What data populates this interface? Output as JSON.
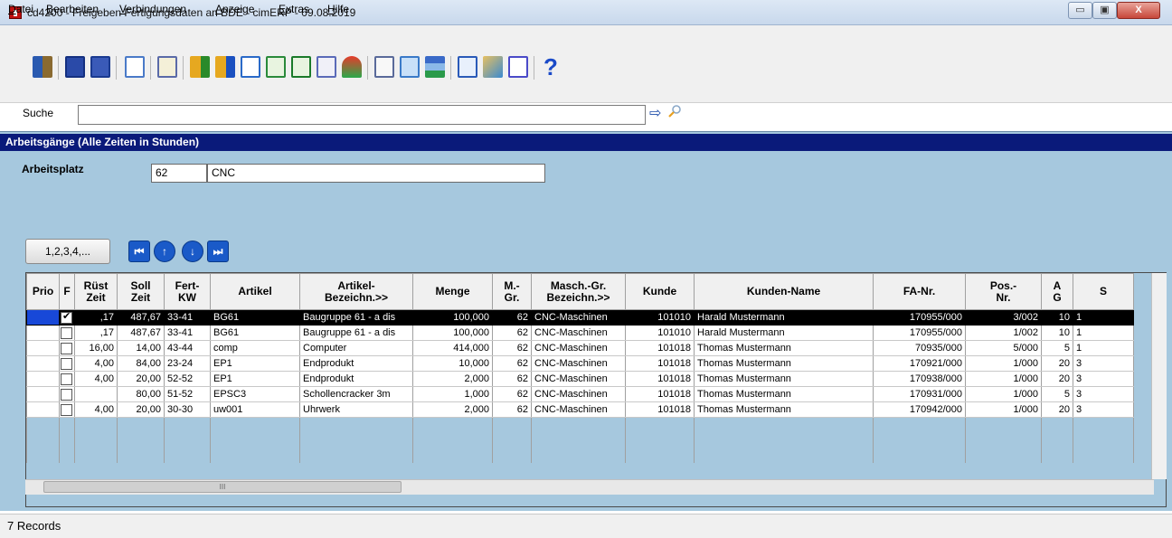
{
  "window": {
    "title": "cd4200 - Freigeben Fertigungsdaten an BDE - cimERP - 09.08.2019",
    "minimize_label": "▭",
    "maximize_label": "▣",
    "close_label": "X"
  },
  "menu": [
    "Datei",
    "Bearbeiten",
    "Verbindungen",
    "Anzeige",
    "Extras",
    "Hilfe"
  ],
  "toolbar": {
    "icons": [
      "exit-icon",
      "save-close-icon",
      "save-icon",
      "refresh-icon",
      "mail-icon",
      "sort-ascending-icon",
      "sort-descending-icon",
      "calendar-icon",
      "export-icon",
      "excel-icon",
      "copy-icon",
      "filter-icon",
      "edit-icon",
      "select-all-icon",
      "list-icon",
      "window-icon",
      "tools-icon",
      "table-icon",
      "help-icon"
    ],
    "help_label": "?"
  },
  "search": {
    "label": "Suche",
    "value": ""
  },
  "section": {
    "header": "Arbeitsgänge (Alle Zeiten in Stunden)"
  },
  "arbeitsplatz": {
    "label": "Arbeitsplatz",
    "number": "62",
    "name": "CNC"
  },
  "buttons": {
    "numbering": "1,2,3,4,..."
  },
  "table": {
    "columns": [
      "Prio",
      "F",
      "Rüst\nZeit",
      "Soll\nZeit",
      "Fert-\nKW",
      "Artikel",
      "Artikel-\nBezeichn.>>",
      "Menge",
      "M.-\nGr.",
      "Masch.-Gr.\nBezeichn.>>",
      "Kunde",
      "Kunden-Name",
      "FA-Nr.",
      "Pos.-\nNr.",
      "A\nG",
      "S"
    ],
    "rows": [
      {
        "prio": "",
        "f": true,
        "ruest": ",17",
        "soll": "487,67",
        "kw": "33-41",
        "artikel": "BG61",
        "bez": "Baugruppe 61 - a dis",
        "menge": "100,000",
        "mgr": "62",
        "masch": "CNC-Maschinen",
        "kunde": "101010",
        "name": "Harald Mustermann",
        "fa": "170955/000",
        "pos": "3/002",
        "ag": "10",
        "s": "1"
      },
      {
        "prio": "",
        "f": false,
        "ruest": ",17",
        "soll": "487,67",
        "kw": "33-41",
        "artikel": "BG61",
        "bez": "Baugruppe 61 - a dis",
        "menge": "100,000",
        "mgr": "62",
        "masch": "CNC-Maschinen",
        "kunde": "101010",
        "name": "Harald Mustermann",
        "fa": "170955/000",
        "pos": "1/002",
        "ag": "10",
        "s": "1"
      },
      {
        "prio": "",
        "f": false,
        "ruest": "16,00",
        "soll": "14,00",
        "kw": "43-44",
        "artikel": "comp",
        "bez": "Computer",
        "menge": "414,000",
        "mgr": "62",
        "masch": "CNC-Maschinen",
        "kunde": "101018",
        "name": "Thomas Mustermann",
        "fa": "70935/000",
        "pos": "5/000",
        "ag": "5",
        "s": "1"
      },
      {
        "prio": "",
        "f": false,
        "ruest": "4,00",
        "soll": "84,00",
        "kw": "23-24",
        "artikel": "EP1",
        "bez": "Endprodukt",
        "menge": "10,000",
        "mgr": "62",
        "masch": "CNC-Maschinen",
        "kunde": "101018",
        "name": "Thomas Mustermann",
        "fa": "170921/000",
        "pos": "1/000",
        "ag": "20",
        "s": "3"
      },
      {
        "prio": "",
        "f": false,
        "ruest": "4,00",
        "soll": "20,00",
        "kw": "52-52",
        "artikel": "EP1",
        "bez": "Endprodukt",
        "menge": "2,000",
        "mgr": "62",
        "masch": "CNC-Maschinen",
        "kunde": "101018",
        "name": "Thomas Mustermann",
        "fa": "170938/000",
        "pos": "1/000",
        "ag": "20",
        "s": "3"
      },
      {
        "prio": "",
        "f": false,
        "ruest": "",
        "soll": "80,00",
        "kw": "51-52",
        "artikel": "EPSC3",
        "bez": "Schollencracker 3m",
        "menge": "1,000",
        "mgr": "62",
        "masch": "CNC-Maschinen",
        "kunde": "101018",
        "name": "Thomas Mustermann",
        "fa": "170931/000",
        "pos": "1/000",
        "ag": "5",
        "s": "3"
      },
      {
        "prio": "",
        "f": false,
        "ruest": "4,00",
        "soll": "20,00",
        "kw": "30-30",
        "artikel": "uw001",
        "bez": "Uhrwerk",
        "menge": "2,000",
        "mgr": "62",
        "masch": "CNC-Maschinen",
        "kunde": "101018",
        "name": "Thomas Mustermann",
        "fa": "170942/000",
        "pos": "1/000",
        "ag": "20",
        "s": "3"
      }
    ]
  },
  "scrollbar": {
    "grip_label": "III"
  },
  "status": {
    "text": "7 Records"
  }
}
